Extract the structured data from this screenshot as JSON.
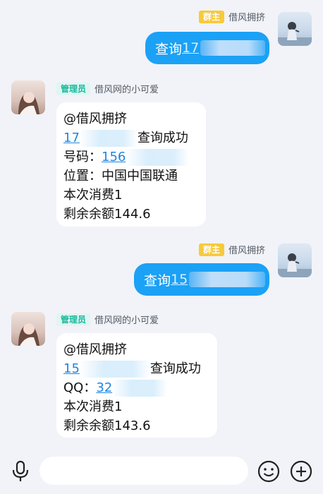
{
  "messages": [
    {
      "sender": "借风拥挤",
      "badge": "群主",
      "text": "查询",
      "link_prefix": "17"
    },
    {
      "sender": "借风网的小可爱",
      "badge": "管理员",
      "mention": "@借风拥挤",
      "link_prefix": "17",
      "result_text": "查询成功",
      "phone_label": "号码：",
      "phone_prefix": "156",
      "location": "位置：中国中国联通",
      "cost": "本次消费1",
      "balance": "剩余余额144.6"
    },
    {
      "sender": "借风拥挤",
      "badge": "群主",
      "text": "查询",
      "link_prefix": "15"
    },
    {
      "sender": "借风网的小可爱",
      "badge": "管理员",
      "mention": "@借风拥挤",
      "link_prefix": "15",
      "result_text": "查询成功",
      "qq_label": "QQ：",
      "qq_prefix": "32",
      "cost": "本次消费1",
      "balance": "剩余余额143.6"
    }
  ],
  "colors": {
    "bubble_out": "#1ba1f6",
    "owner_badge": "#f8c93a",
    "admin_badge_text": "#1bb89c",
    "link": "#1c86e3"
  },
  "input_bar": {
    "voice_icon": "microphone-icon",
    "emoji_icon": "smile-icon",
    "more_icon": "plus-circle-icon"
  }
}
